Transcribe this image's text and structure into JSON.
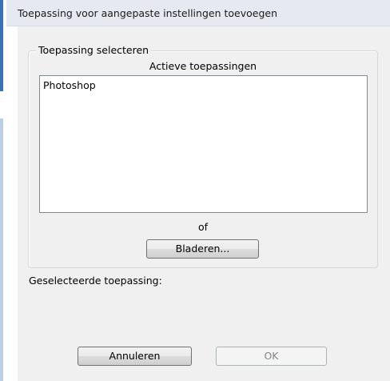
{
  "window": {
    "title": "Toepassing voor aangepaste instellingen toevoegen"
  },
  "select_group": {
    "legend": "Toepassing selecteren",
    "list_heading": "Actieve toepassingen",
    "items": [
      "Photoshop"
    ],
    "or_label": "of",
    "browse_label": "Bladeren..."
  },
  "selected_label": "Geselecteerde toepassing:",
  "buttons": {
    "cancel_label": "Annuleren",
    "ok_label": "OK"
  },
  "colors": {
    "window_frame_accent": "#3a72b8",
    "dialog_background": "#f0f0f0",
    "titlebar_background": "#e6eaf0"
  }
}
